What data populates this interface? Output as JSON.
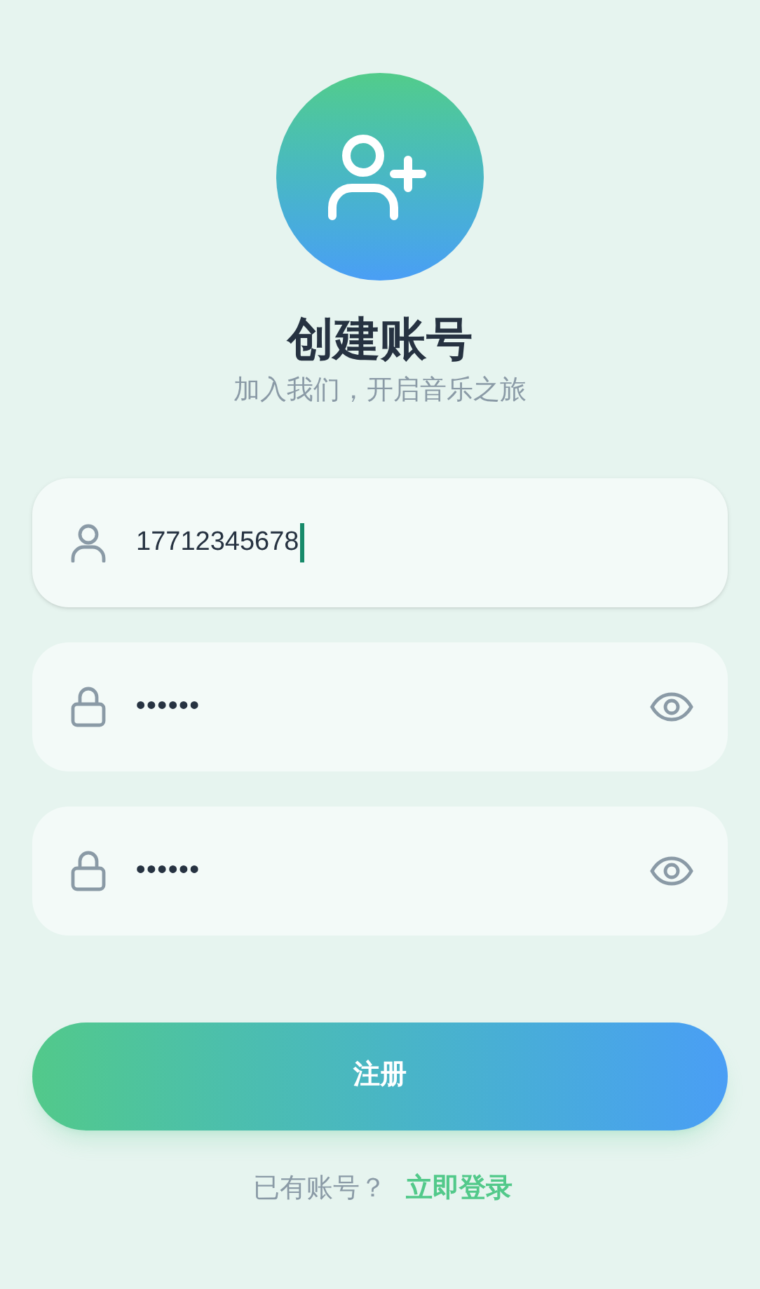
{
  "header": {
    "title": "创建账号",
    "subtitle": "加入我们，开启音乐之旅"
  },
  "fields": [
    {
      "kind": "phone",
      "value": "17712345678",
      "focused": true
    },
    {
      "kind": "password",
      "value": "••••••",
      "focused": false
    },
    {
      "kind": "password",
      "value": "••••••",
      "focused": false
    }
  ],
  "submit": {
    "label": "注册"
  },
  "footer": {
    "prompt": "已有账号？",
    "link": "立即登录"
  }
}
